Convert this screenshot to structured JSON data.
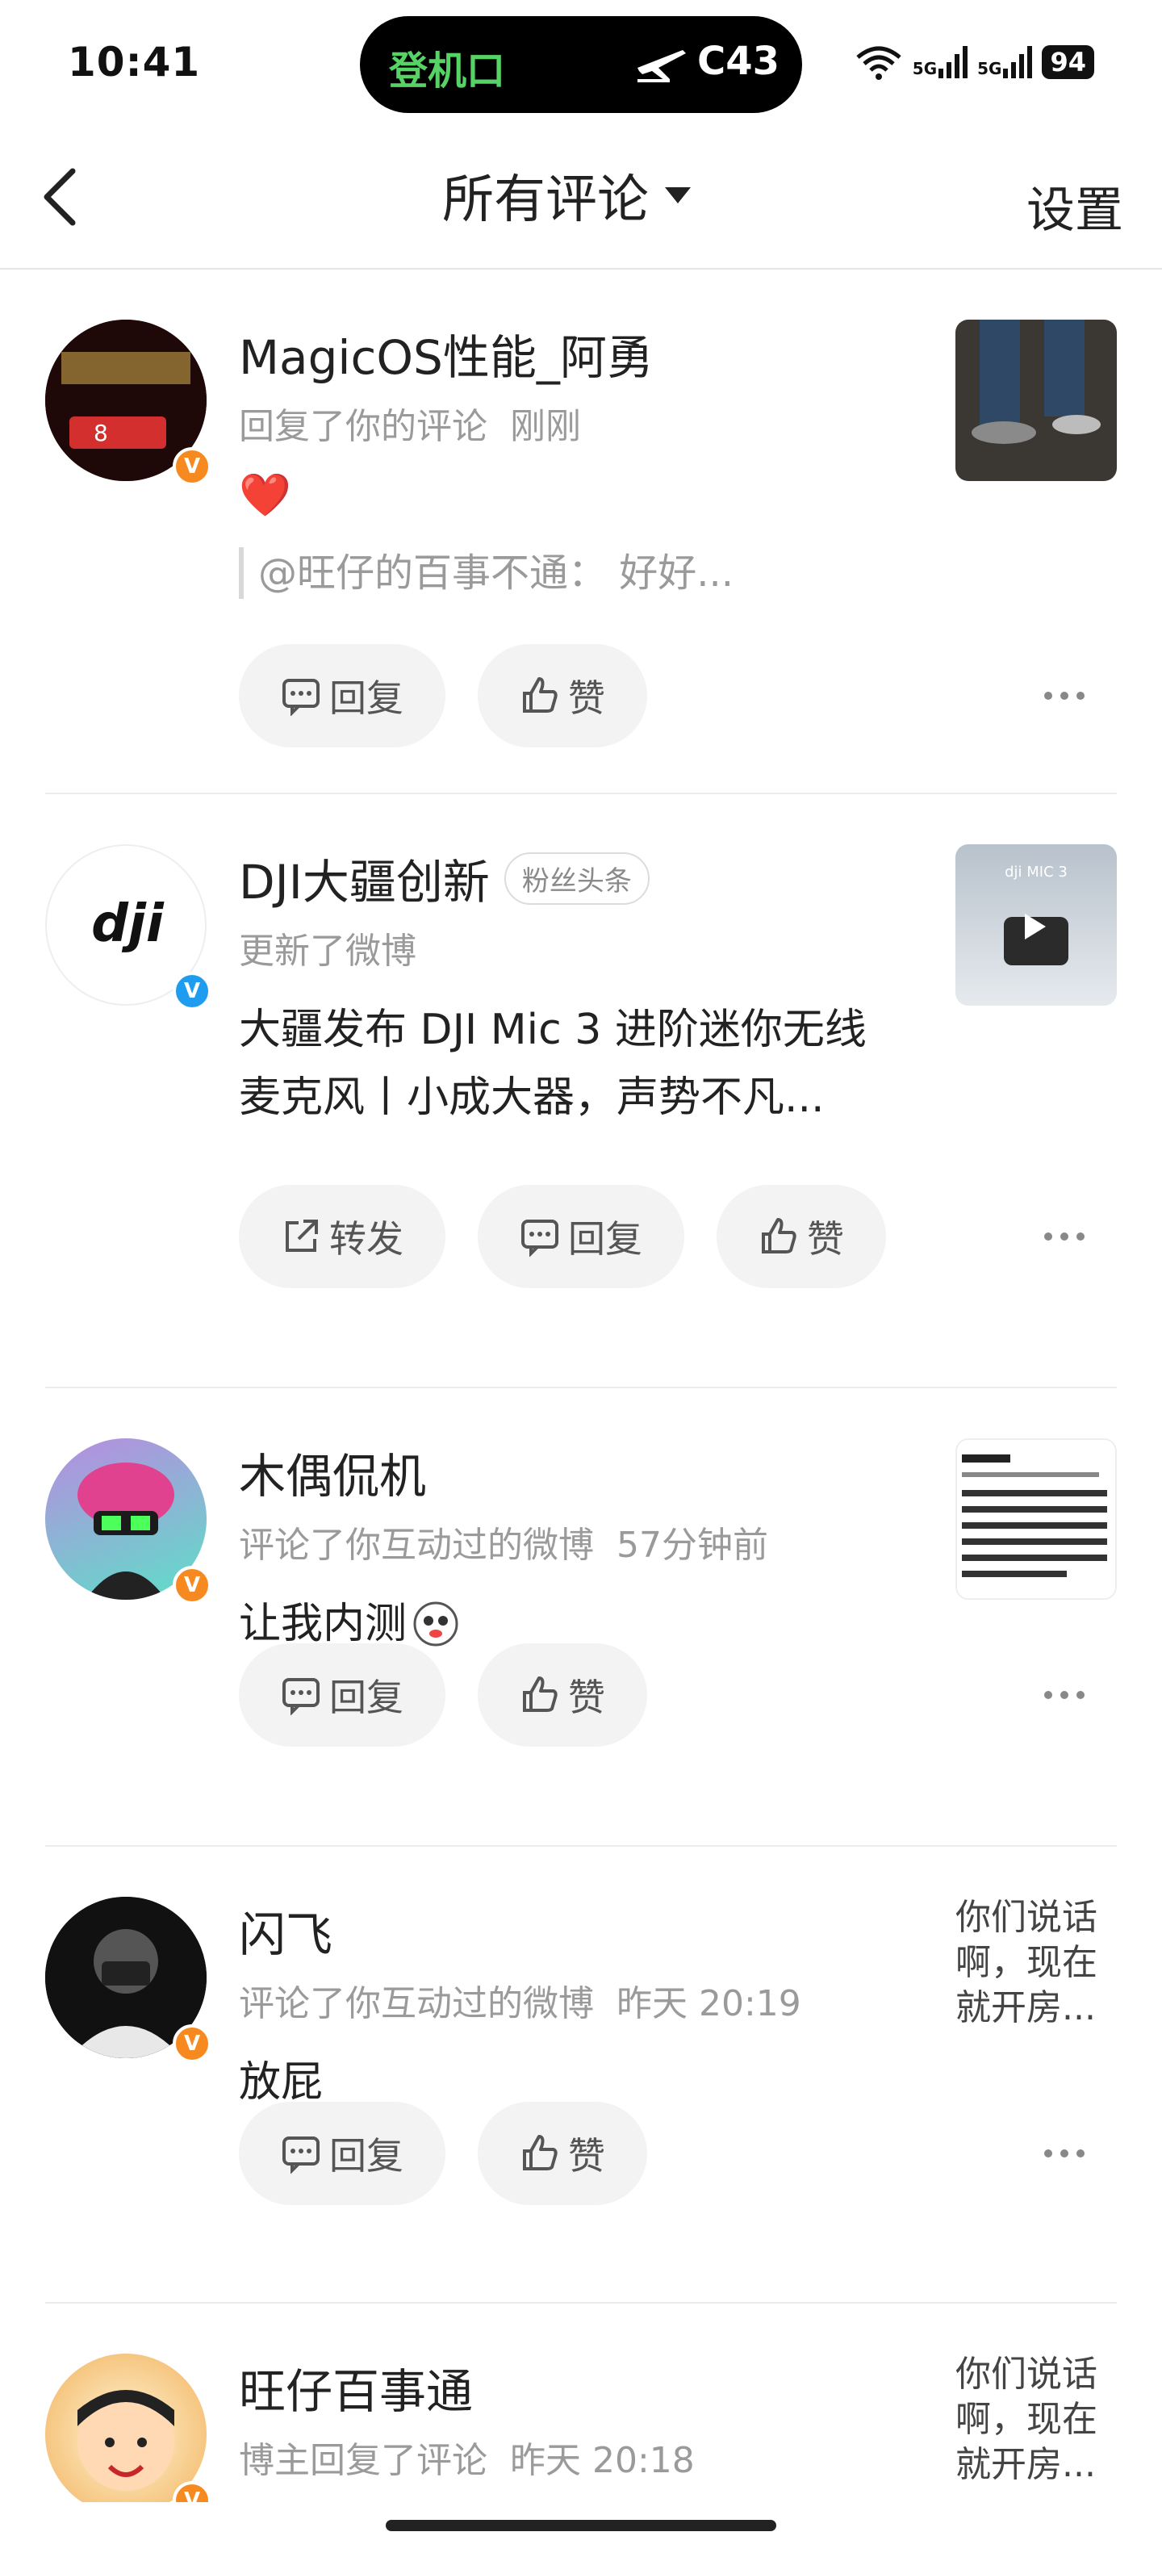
{
  "status_bar": {
    "time": "10:41",
    "island_gate": "登机口",
    "island_code": "C43",
    "signal1": "5G",
    "signal2": "5G",
    "battery": "94"
  },
  "header": {
    "title": "所有评论",
    "settings": "设置"
  },
  "items": [
    {
      "name": "MagicOS性能_阿勇",
      "action": "回复了你的评论",
      "time": "刚刚",
      "body": "❤️",
      "quote": "@旺仔的百事不通： 好好...",
      "reply_label": "回复",
      "like_label": "赞"
    },
    {
      "name": "DJI大疆创新",
      "badge": "粉丝头条",
      "action": "更新了微博",
      "body": "大疆发布 DJI Mic 3 进阶迷你无线麦克风丨小成大器，声势不凡...",
      "forward_label": "转发",
      "reply_label": "回复",
      "like_label": "赞"
    },
    {
      "name": "木偶侃机",
      "action": "评论了你互动过的微博",
      "time": "57分钟前",
      "body": "让我内测",
      "reply_label": "回复",
      "like_label": "赞"
    },
    {
      "name": "闪飞",
      "action": "评论了你互动过的微博",
      "time": "昨天 20:19",
      "body": "放屁",
      "thumb_text": "你们说话啊，现在就开房...",
      "reply_label": "回复",
      "like_label": "赞"
    },
    {
      "name": "旺仔百事通",
      "action": "博主回复了评论",
      "time": "昨天 20:18",
      "thumb_text": "你们说话啊，现在就开房..."
    }
  ],
  "colors": {
    "accent_green": "#56d364",
    "verify_orange": "#f68a20",
    "verify_blue": "#1e9cf0"
  }
}
